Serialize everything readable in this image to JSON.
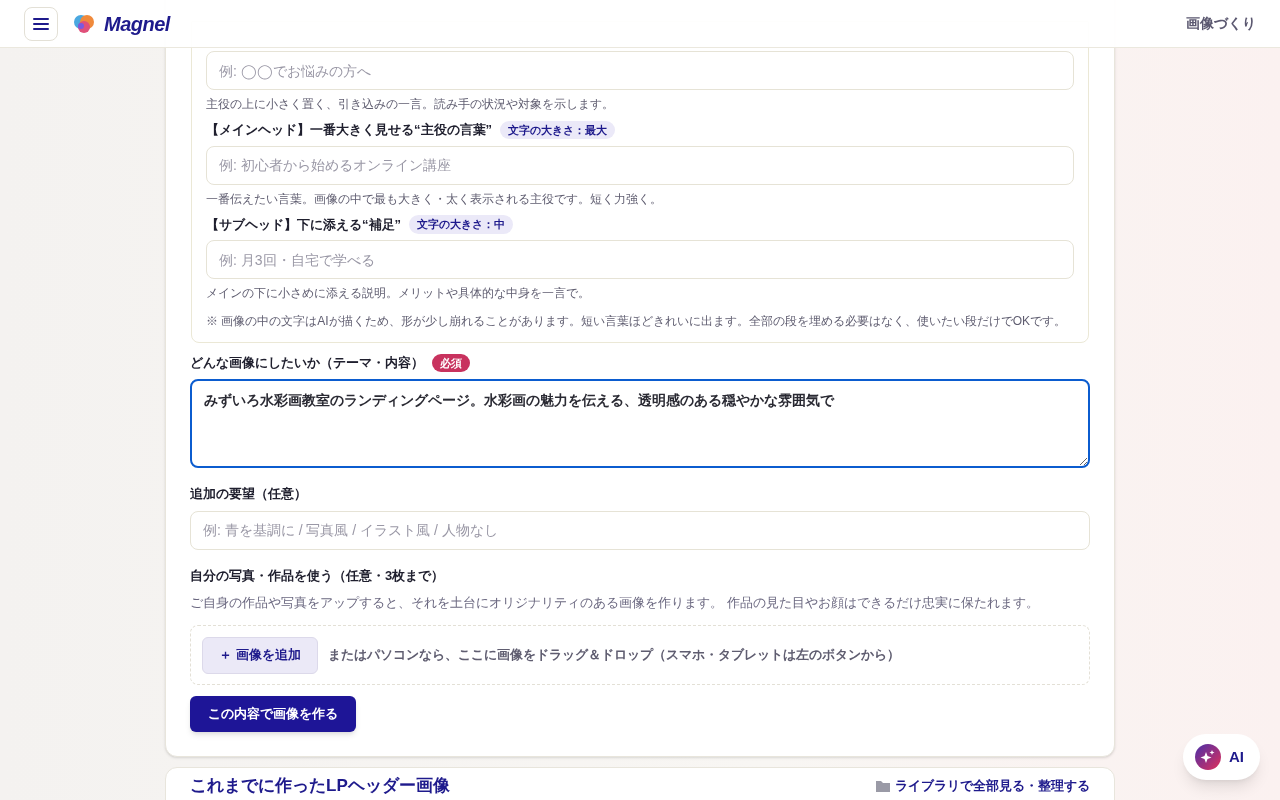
{
  "header": {
    "brand": "Magnel",
    "nav_link": "画像づくり"
  },
  "text_lines": [
    {
      "input_placeholder": "例: ◯◯でお悩みの方へ",
      "help": "主役の上に小さく置く、引き込みの一言。読み手の状況や対象を示します。"
    },
    {
      "label": "【メインヘッド】一番大きく見せる“主役の言葉”",
      "size_badge": "文字の大きさ：最大",
      "input_placeholder": "例: 初心者から始めるオンライン講座",
      "help": "一番伝えたい言葉。画像の中で最も大きく・太く表示される主役です。短く力強く。"
    },
    {
      "label": "【サブヘッド】下に添える“補足”",
      "size_badge": "文字の大きさ：中",
      "input_placeholder": "例: 月3回・自宅で学べる",
      "help": "メインの下に小さめに添える説明。メリットや具体的な中身を一言で。"
    }
  ],
  "text_note": "※ 画像の中の文字はAIが描くため、形が少し崩れることがあります。短い言葉ほどきれいに出ます。全部の段を埋める必要はなく、使いたい段だけでOKです。",
  "theme": {
    "label": "どんな画像にしたいか（テーマ・内容）",
    "required_badge": "必須",
    "value": "みずいろ水彩画教室のランディングページ。水彩画の魅力を伝える、透明感のある穏やかな雰囲気で",
    "focused": true
  },
  "extra": {
    "label": "追加の要望（任意）",
    "placeholder": "例: 青を基調に / 写真風 / イラスト風 / 人物なし"
  },
  "photos": {
    "label": "自分の写真・作品を使う（任意・3枚まで）",
    "description": "ご自身の作品や写真をアップすると、それを土台にオリジナリティのある画像を作ります。 作品の見た目やお顔はできるだけ忠実に保たれます。",
    "add_button": "＋ 画像を追加",
    "drop_hint": "またはパソコンなら、ここに画像をドラッグ＆ドロップ（スマホ・タブレットは左のボタンから）"
  },
  "submit_button": "この内容で画像を作る",
  "history": {
    "title": "これまでに作ったLPヘッダー画像",
    "library_link": "ライブラリで全部見る・整理する"
  },
  "ai_button": "AI"
}
